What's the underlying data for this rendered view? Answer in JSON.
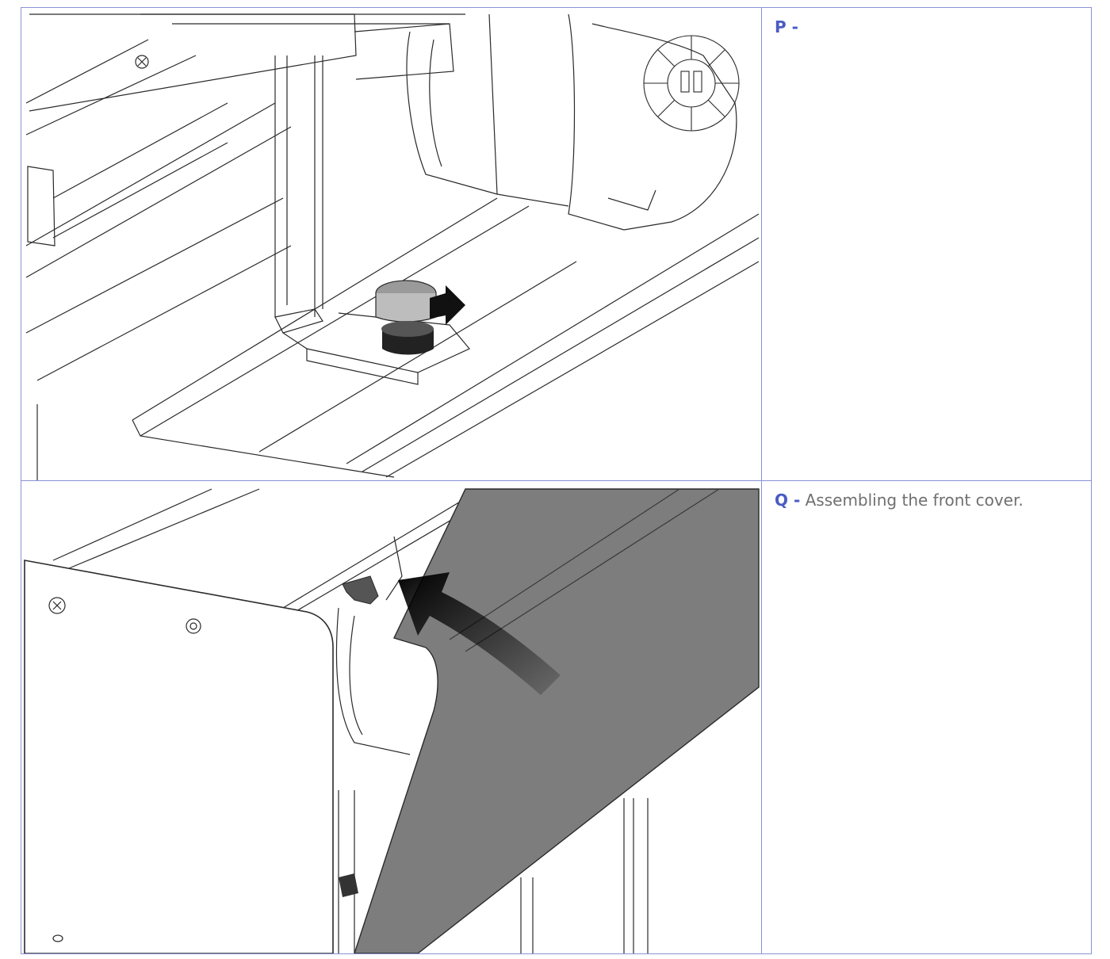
{
  "steps": [
    {
      "letter": "P -",
      "text": ""
    },
    {
      "letter": "Q -",
      "text": "Assembling the front cover."
    }
  ],
  "colors": {
    "border": "#8a93d6",
    "step_letter": "#4a5bc4",
    "step_text": "#6f6f6f",
    "cover_panel": "#7d7d7d",
    "line_art": "#2a2a2a"
  }
}
